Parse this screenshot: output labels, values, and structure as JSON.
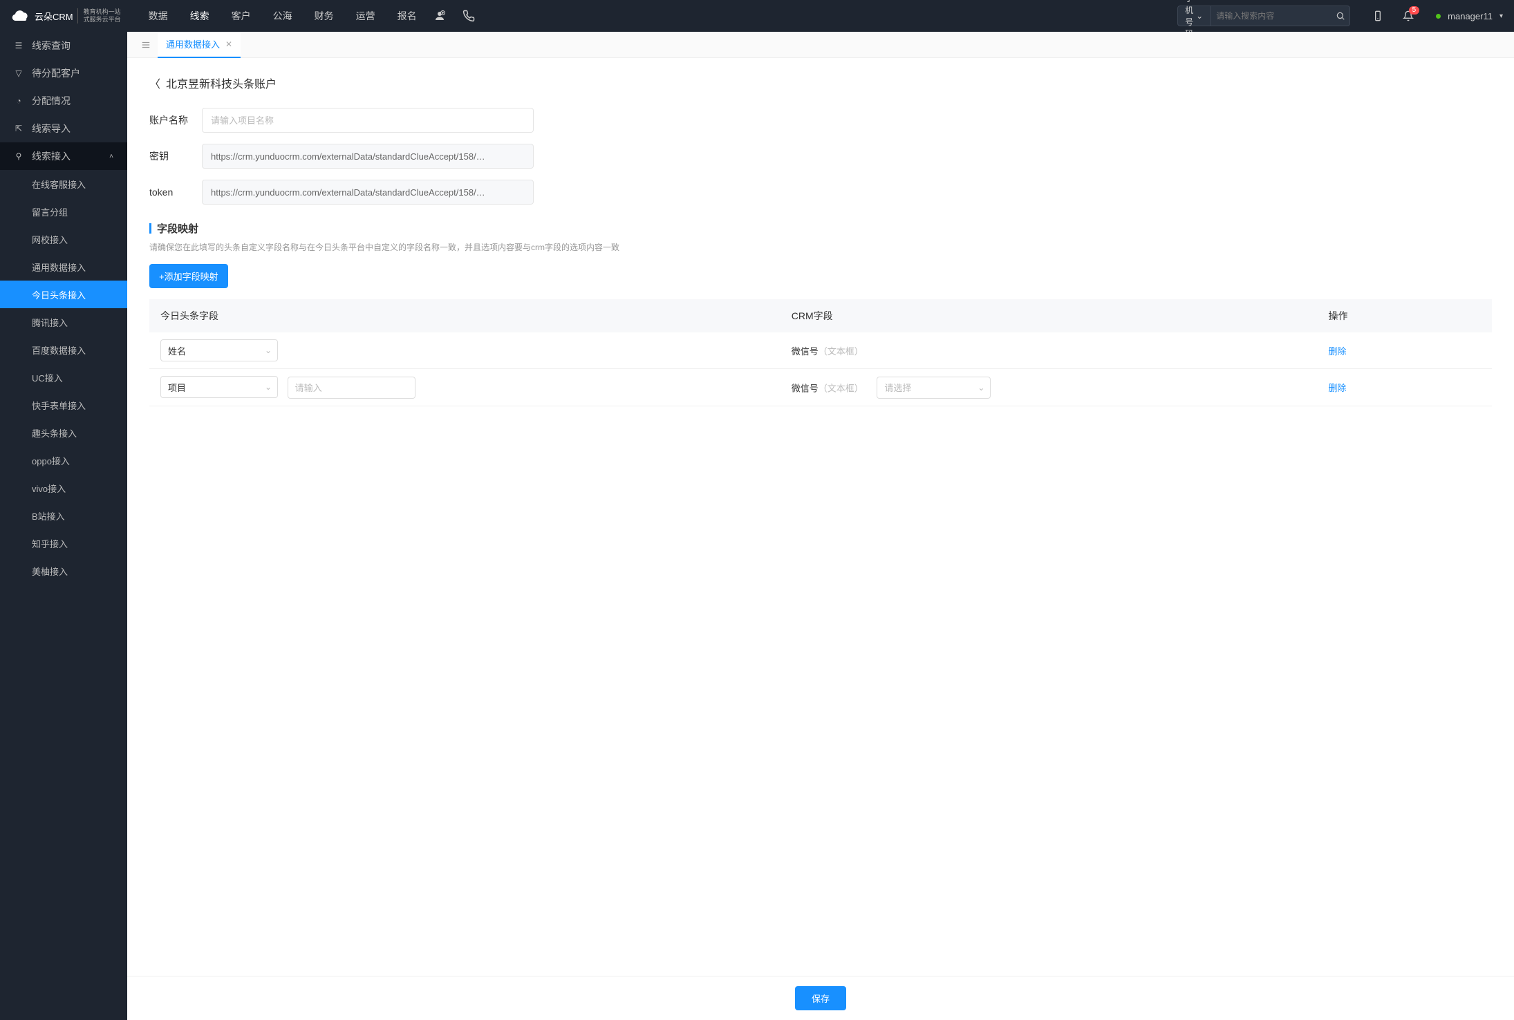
{
  "topnav": {
    "items": [
      "数据",
      "线索",
      "客户",
      "公海",
      "财务",
      "运营",
      "报名"
    ],
    "active_index": 1
  },
  "logo": {
    "name": "云朵CRM",
    "tagline_line1": "教育机构一站",
    "tagline_line2": "式服务云平台"
  },
  "search": {
    "select_label": "手机号码",
    "placeholder": "请输入搜索内容"
  },
  "notification_count": "5",
  "user": {
    "name": "manager11"
  },
  "sidebar": {
    "items": [
      {
        "icon": "list",
        "label": "线索查询"
      },
      {
        "icon": "filter",
        "label": "待分配客户"
      },
      {
        "icon": "pie",
        "label": "分配情况"
      },
      {
        "icon": "export",
        "label": "线索导入"
      },
      {
        "icon": "plug",
        "label": "线索接入",
        "expanded": true
      }
    ],
    "subitems": [
      "在线客服接入",
      "留言分组",
      "网校接入",
      "通用数据接入",
      "今日头条接入",
      "腾讯接入",
      "百度数据接入",
      "UC接入",
      "快手表单接入",
      "趣头条接入",
      "oppo接入",
      "vivo接入",
      "B站接入",
      "知乎接入",
      "美柚接入"
    ],
    "active_sub_index": 4
  },
  "tabs": {
    "active_label": "通用数据接入"
  },
  "page": {
    "title": "北京昱新科技头条账户",
    "form": {
      "name_label": "账户名称",
      "name_placeholder": "请输入项目名称",
      "secret_label": "密钥",
      "secret_value": "https://crm.yunduocrm.com/externalData/standardClueAccept/158/…",
      "token_label": "token",
      "token_value": "https://crm.yunduocrm.com/externalData/standardClueAccept/158/…"
    },
    "mapping": {
      "title": "字段映射",
      "hint": "请确保您在此填写的头条自定义字段名称与在今日头条平台中自定义的字段名称一致，并且选项内容要与crm字段的选项内容一致",
      "add_button": "+添加字段映射",
      "columns": [
        "今日头条字段",
        "CRM字段",
        "操作"
      ],
      "rows": [
        {
          "field_select": "姓名",
          "crm_label": "微信号",
          "crm_type": "（文本框）",
          "delete": "删除"
        },
        {
          "field_select": "项目",
          "input_placeholder": "请输入",
          "crm_label": "微信号",
          "crm_type": "（文本框）",
          "crm_select_placeholder": "请选择",
          "delete": "删除"
        }
      ]
    },
    "save_button": "保存"
  }
}
